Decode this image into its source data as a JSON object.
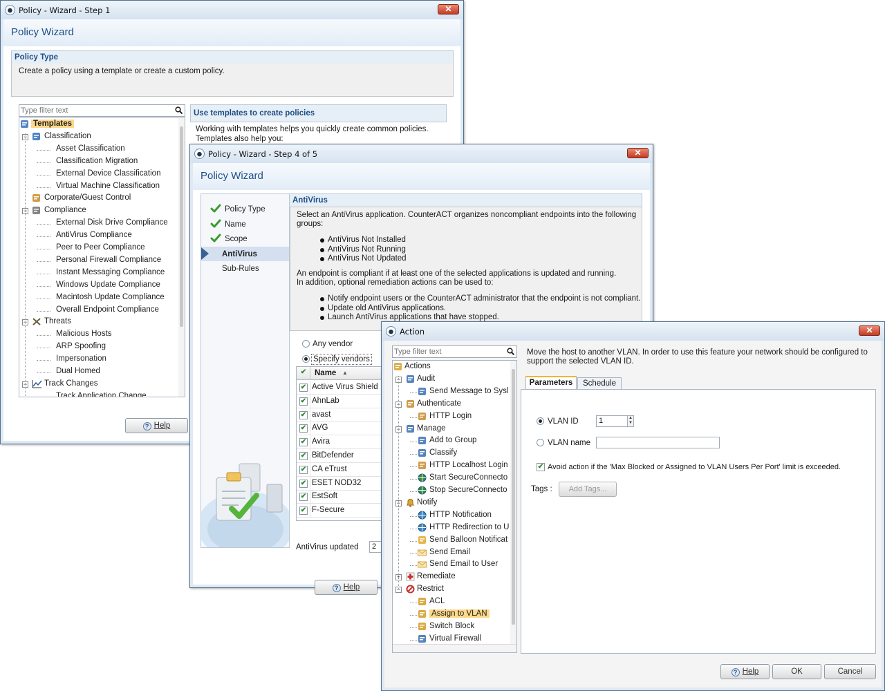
{
  "win1": {
    "title": "Policy - Wizard - Step 1",
    "header": "Policy Wizard",
    "section_title": "Policy Type",
    "section_desc": "Create a policy using a template or create a custom policy.",
    "filter_placeholder": "Type filter text",
    "tree": [
      {
        "label": "Templates",
        "icon": "templates-icon",
        "selected": true
      },
      {
        "label": "Classification",
        "icon": "classification-icon"
      },
      {
        "label": "Asset Classification"
      },
      {
        "label": "Classification Migration"
      },
      {
        "label": "External Device Classification"
      },
      {
        "label": "Virtual Machine Classification"
      },
      {
        "label": "Corporate/Guest Control",
        "icon": "user-lock-icon"
      },
      {
        "label": "Compliance",
        "icon": "clipboard-icon"
      },
      {
        "label": "External Disk Drive Compliance"
      },
      {
        "label": "AntiVirus Compliance"
      },
      {
        "label": "Peer to Peer Compliance"
      },
      {
        "label": "Personal Firewall Compliance"
      },
      {
        "label": "Instant Messaging Compliance"
      },
      {
        "label": "Windows Update Compliance"
      },
      {
        "label": "Macintosh Update Compliance"
      },
      {
        "label": "Overall Endpoint Compliance"
      },
      {
        "label": "Threats",
        "icon": "threats-icon"
      },
      {
        "label": "Malicious Hosts"
      },
      {
        "label": "ARP Spoofing"
      },
      {
        "label": "Impersonation"
      },
      {
        "label": "Dual Homed"
      },
      {
        "label": "Track Changes",
        "icon": "chart-icon"
      },
      {
        "label": "Track Application Change"
      }
    ],
    "right_title": "Use templates to create policies",
    "right_text_1": "Working with templates helps you quickly create common policies.",
    "right_text_2": "Templates also help you:",
    "help_label": "Help"
  },
  "win2": {
    "title": "Policy - Wizard - Step 4 of 5",
    "header": "Policy Wizard",
    "steps": [
      {
        "label": "Policy Type",
        "done": true
      },
      {
        "label": "Name",
        "done": true
      },
      {
        "label": "Scope",
        "done": true
      },
      {
        "label": "AntiVirus",
        "current": true
      },
      {
        "label": "Sub-Rules"
      }
    ],
    "section_title": "AntiVirus",
    "intro_1": "Select an AntiVirus application. CounterACT organizes noncompliant endpoints into the following",
    "intro_2": "groups:",
    "groups": [
      "AntiVirus Not Installed",
      "AntiVirus Not Running",
      "AntiVirus Not Updated"
    ],
    "compliant_1": "An endpoint is compliant if at least one of the selected applications is updated and running.",
    "compliant_2": "In addition, optional remediation actions can be used to:",
    "actions": [
      "Notify endpoint users or the CounterACT administrator that the endpoint is not compliant.",
      "Update old AntiVirus applications.",
      "Launch AntiVirus applications that have stopped."
    ],
    "any_vendor": "Any vendor",
    "specify_vendors": "Specify vendors",
    "column_name": "Name",
    "vendors": [
      "Active Virus Shield",
      "AhnLab",
      "avast",
      "AVG",
      "Avira",
      "BitDefender",
      "CA eTrust",
      "ESET NOD32",
      "EstSoft",
      "F-Secure"
    ],
    "updated_label": "AntiVirus updated",
    "updated_value": "2",
    "help_label": "Help"
  },
  "win3": {
    "title": "Action",
    "filter_placeholder": "Type filter text",
    "tree": [
      {
        "label": "Actions",
        "icon": "actions-icon",
        "level": 0
      },
      {
        "label": "Audit",
        "icon": "audit-icon",
        "level": 1,
        "expanded": true
      },
      {
        "label": "Send Message to Sysl",
        "icon": "message-icon",
        "level": 2
      },
      {
        "label": "Authenticate",
        "icon": "user-icon",
        "level": 1,
        "expanded": true
      },
      {
        "label": "HTTP Login",
        "icon": "login-icon",
        "level": 2
      },
      {
        "label": "Manage",
        "icon": "manage-icon",
        "level": 1,
        "expanded": true
      },
      {
        "label": "Add to Group",
        "icon": "group-icon",
        "level": 2
      },
      {
        "label": "Classify",
        "icon": "classify-icon",
        "level": 2
      },
      {
        "label": "HTTP Localhost Login",
        "icon": "login-icon",
        "level": 2
      },
      {
        "label": "Start SecureConnecto",
        "icon": "connector-icon",
        "level": 2
      },
      {
        "label": "Stop SecureConnecto",
        "icon": "connector-icon",
        "level": 2
      },
      {
        "label": "Notify",
        "icon": "bell-icon",
        "level": 1,
        "expanded": true
      },
      {
        "label": "HTTP Notification",
        "icon": "globe-icon",
        "level": 2
      },
      {
        "label": "HTTP Redirection to U",
        "icon": "globe-icon",
        "level": 2
      },
      {
        "label": "Send Balloon Notificat",
        "icon": "balloon-icon",
        "level": 2
      },
      {
        "label": "Send Email",
        "icon": "email-icon",
        "level": 2
      },
      {
        "label": "Send Email to User",
        "icon": "email-icon",
        "level": 2
      },
      {
        "label": "Remediate",
        "icon": "remediate-icon",
        "level": 1,
        "expanded": false
      },
      {
        "label": "Restrict",
        "icon": "restrict-icon",
        "level": 1,
        "expanded": true
      },
      {
        "label": "ACL",
        "icon": "acl-icon",
        "level": 2
      },
      {
        "label": "Assign to VLAN",
        "icon": "vlan-icon",
        "level": 2,
        "selected": true
      },
      {
        "label": "Switch Block",
        "icon": "switch-icon",
        "level": 2
      },
      {
        "label": "Virtual Firewall",
        "icon": "firewall-icon",
        "level": 2
      }
    ],
    "description_1": "Move the host to another VLAN. In order to use this feature your network should be configured to",
    "description_2": "support the selected VLAN ID.",
    "tabs": [
      "Parameters",
      "Schedule"
    ],
    "vlan_id_label": "VLAN ID",
    "vlan_id_value": "1",
    "vlan_name_label": "VLAN name",
    "avoid_label": "Avoid action if the 'Max Blocked or Assigned to VLAN Users Per Port' limit is exceeded.",
    "tags_label": "Tags :",
    "add_tags_label": "Add Tags...",
    "help_label": "Help",
    "ok_label": "OK",
    "cancel_label": "Cancel"
  }
}
